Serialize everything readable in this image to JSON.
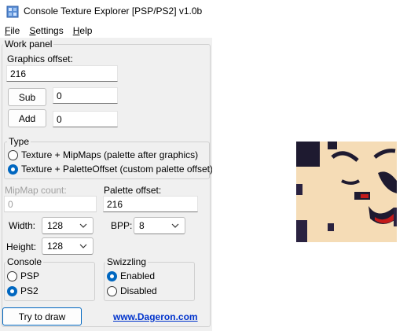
{
  "window": {
    "title": "Console Texture Explorer [PSP/PS2] v1.0b"
  },
  "menu": [
    {
      "accel": "F",
      "rest": "ile"
    },
    {
      "accel": "S",
      "rest": "ettings"
    },
    {
      "accel": "H",
      "rest": "elp"
    }
  ],
  "work_panel": {
    "label": "Work panel",
    "graphics_offset_label": "Graphics offset:",
    "graphics_offset_value": "216",
    "sub_button": "Sub",
    "sub_value": "0",
    "add_button": "Add",
    "add_value": "0"
  },
  "type_group": {
    "label": "Type",
    "options": [
      {
        "label": "Texture + MipMaps (palette after graphics)",
        "selected": false
      },
      {
        "label": "Texture + PaletteOffset (custom palette offset)",
        "selected": true
      }
    ]
  },
  "mipmap": {
    "label": "MipMap count:",
    "value": "0"
  },
  "palette": {
    "label": "Palette offset:",
    "value": "216"
  },
  "width": {
    "label": "Width:",
    "value": "128"
  },
  "height": {
    "label": "Height:",
    "value": "128"
  },
  "bpp": {
    "label": "BPP:",
    "value": "8"
  },
  "console_group": {
    "label": "Console",
    "options": [
      {
        "label": "PSP",
        "selected": false
      },
      {
        "label": "PS2",
        "selected": true
      }
    ]
  },
  "swizzling_group": {
    "label": "Swizzling",
    "options": [
      {
        "label": "Enabled",
        "selected": true
      },
      {
        "label": "Disabled",
        "selected": false
      }
    ]
  },
  "try_button": "Try to draw",
  "link": "www.Dageron.com",
  "colors": {
    "accent": "#0067c0",
    "link": "#0033cc",
    "texture_bg": "#f5dcb6"
  }
}
